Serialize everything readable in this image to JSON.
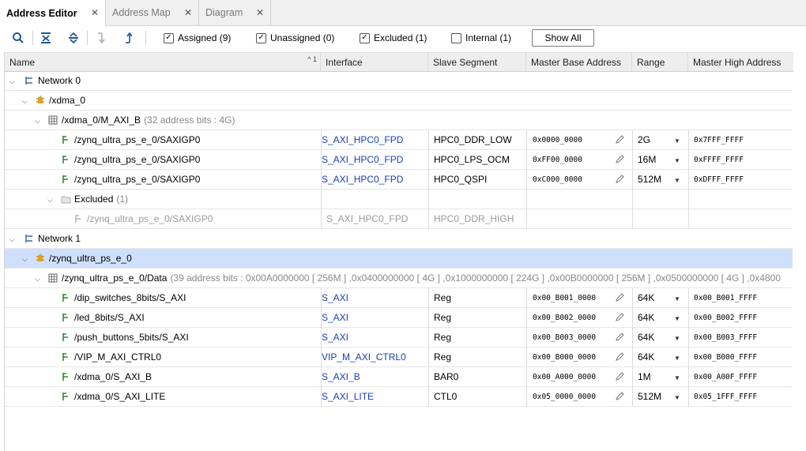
{
  "tabs": [
    {
      "label": "Address Editor",
      "active": true
    },
    {
      "label": "Address Map",
      "active": false
    },
    {
      "label": "Diagram",
      "active": false
    }
  ],
  "toolbar": {
    "icons": [
      "search-icon",
      "collapse-all-icon",
      "expand-all-icon",
      "move-down-icon",
      "move-up-icon"
    ],
    "filters": [
      {
        "label": "Assigned (9)",
        "checked": true
      },
      {
        "label": "Unassigned (0)",
        "checked": true
      },
      {
        "label": "Excluded (1)",
        "checked": true
      },
      {
        "label": "Internal (1)",
        "checked": false
      }
    ],
    "show_all": "Show All"
  },
  "columns": {
    "name": "Name",
    "sort_indicator": "^ 1",
    "interface": "Interface",
    "slave_segment": "Slave Segment",
    "master_base": "Master Base Address",
    "range": "Range",
    "master_high": "Master High Address"
  },
  "tree": {
    "network0": "Network 0",
    "xdma0": "/xdma_0",
    "xdma0_space": "/xdma_0/M_AXI_B",
    "xdma0_space_note": "(32 address bits : 4G)",
    "rows_net0": [
      {
        "name": "/zynq_ultra_ps_e_0/SAXIGP0",
        "interface": "S_AXI_HPC0_FPD",
        "segment": "HPC0_DDR_LOW",
        "base": "0x0000_0000",
        "range": "2G",
        "high": "0x7FFF_FFFF"
      },
      {
        "name": "/zynq_ultra_ps_e_0/SAXIGP0",
        "interface": "S_AXI_HPC0_FPD",
        "segment": "HPC0_LPS_OCM",
        "base": "0xFF00_0000",
        "range": "16M",
        "high": "0xFFFF_FFFF"
      },
      {
        "name": "/zynq_ultra_ps_e_0/SAXIGP0",
        "interface": "S_AXI_HPC0_FPD",
        "segment": "HPC0_QSPI",
        "base": "0xC000_0000",
        "range": "512M",
        "high": "0xDFFF_FFFF"
      }
    ],
    "excluded_label": "Excluded",
    "excluded_count": "(1)",
    "excluded_row": {
      "name": "/zynq_ultra_ps_e_0/SAXIGP0",
      "interface": "S_AXI_HPC0_FPD",
      "segment": "HPC0_DDR_HIGH"
    },
    "network1": "Network 1",
    "zynq": "/zynq_ultra_ps_e_0",
    "zynq_space": "/zynq_ultra_ps_e_0/Data",
    "zynq_space_note": "(39 address bits : 0x00A0000000 [ 256M ] ,0x0400000000 [ 4G ] ,0x1000000000 [ 224G ] ,0x00B0000000 [ 256M ] ,0x0500000000 [ 4G ] ,0x4800",
    "rows_net1": [
      {
        "name": "/dip_switches_8bits/S_AXI",
        "interface": "S_AXI",
        "segment": "Reg",
        "base": "0x00_B001_0000",
        "range": "64K",
        "high": "0x00_B001_FFFF"
      },
      {
        "name": "/led_8bits/S_AXI",
        "interface": "S_AXI",
        "segment": "Reg",
        "base": "0x00_B002_0000",
        "range": "64K",
        "high": "0x00_B002_FFFF"
      },
      {
        "name": "/push_buttons_5bits/S_AXI",
        "interface": "S_AXI",
        "segment": "Reg",
        "base": "0x00_B003_0000",
        "range": "64K",
        "high": "0x00_B003_FFFF"
      },
      {
        "name": "/VIP_M_AXI_CTRL0",
        "interface": "VIP_M_AXI_CTRL0",
        "segment": "Reg",
        "base": "0x00_B000_0000",
        "range": "64K",
        "high": "0x00_B000_FFFF"
      },
      {
        "name": "/xdma_0/S_AXI_B",
        "interface": "S_AXI_B",
        "segment": "BAR0",
        "base": "0x00_A000_0000",
        "range": "1M",
        "high": "0x00_A00F_FFFF"
      },
      {
        "name": "/xdma_0/S_AXI_LITE",
        "interface": "S_AXI_LITE",
        "segment": "CTL0",
        "base": "0x05_0000_0000",
        "range": "512M",
        "high": "0x05_1FFF_FFFF"
      }
    ]
  },
  "colors": {
    "selected_row": "#cfe0fc",
    "link": "#1a3fb8",
    "excluded_text": "#9a9a9a"
  }
}
